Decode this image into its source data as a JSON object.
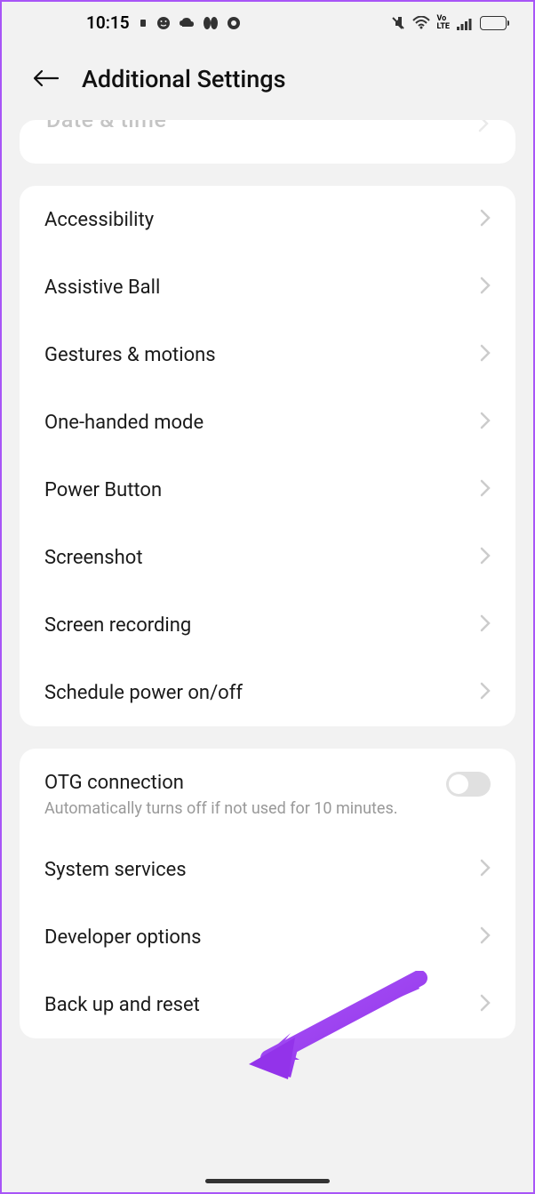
{
  "status": {
    "time": "10:15"
  },
  "header": {
    "title": "Additional Settings"
  },
  "group0": {
    "cutoff_label": "Date & time"
  },
  "group1": {
    "items": [
      {
        "label": "Accessibility"
      },
      {
        "label": "Assistive Ball"
      },
      {
        "label": "Gestures & motions"
      },
      {
        "label": "One-handed mode"
      },
      {
        "label": "Power Button"
      },
      {
        "label": "Screenshot"
      },
      {
        "label": "Screen recording"
      },
      {
        "label": "Schedule power on/off"
      }
    ]
  },
  "group2": {
    "otg": {
      "label": "OTG connection",
      "sub": "Automatically turns off if not used for 10 minutes."
    },
    "items": [
      {
        "label": "System services"
      },
      {
        "label": "Developer options"
      },
      {
        "label": "Back up and reset"
      }
    ]
  }
}
